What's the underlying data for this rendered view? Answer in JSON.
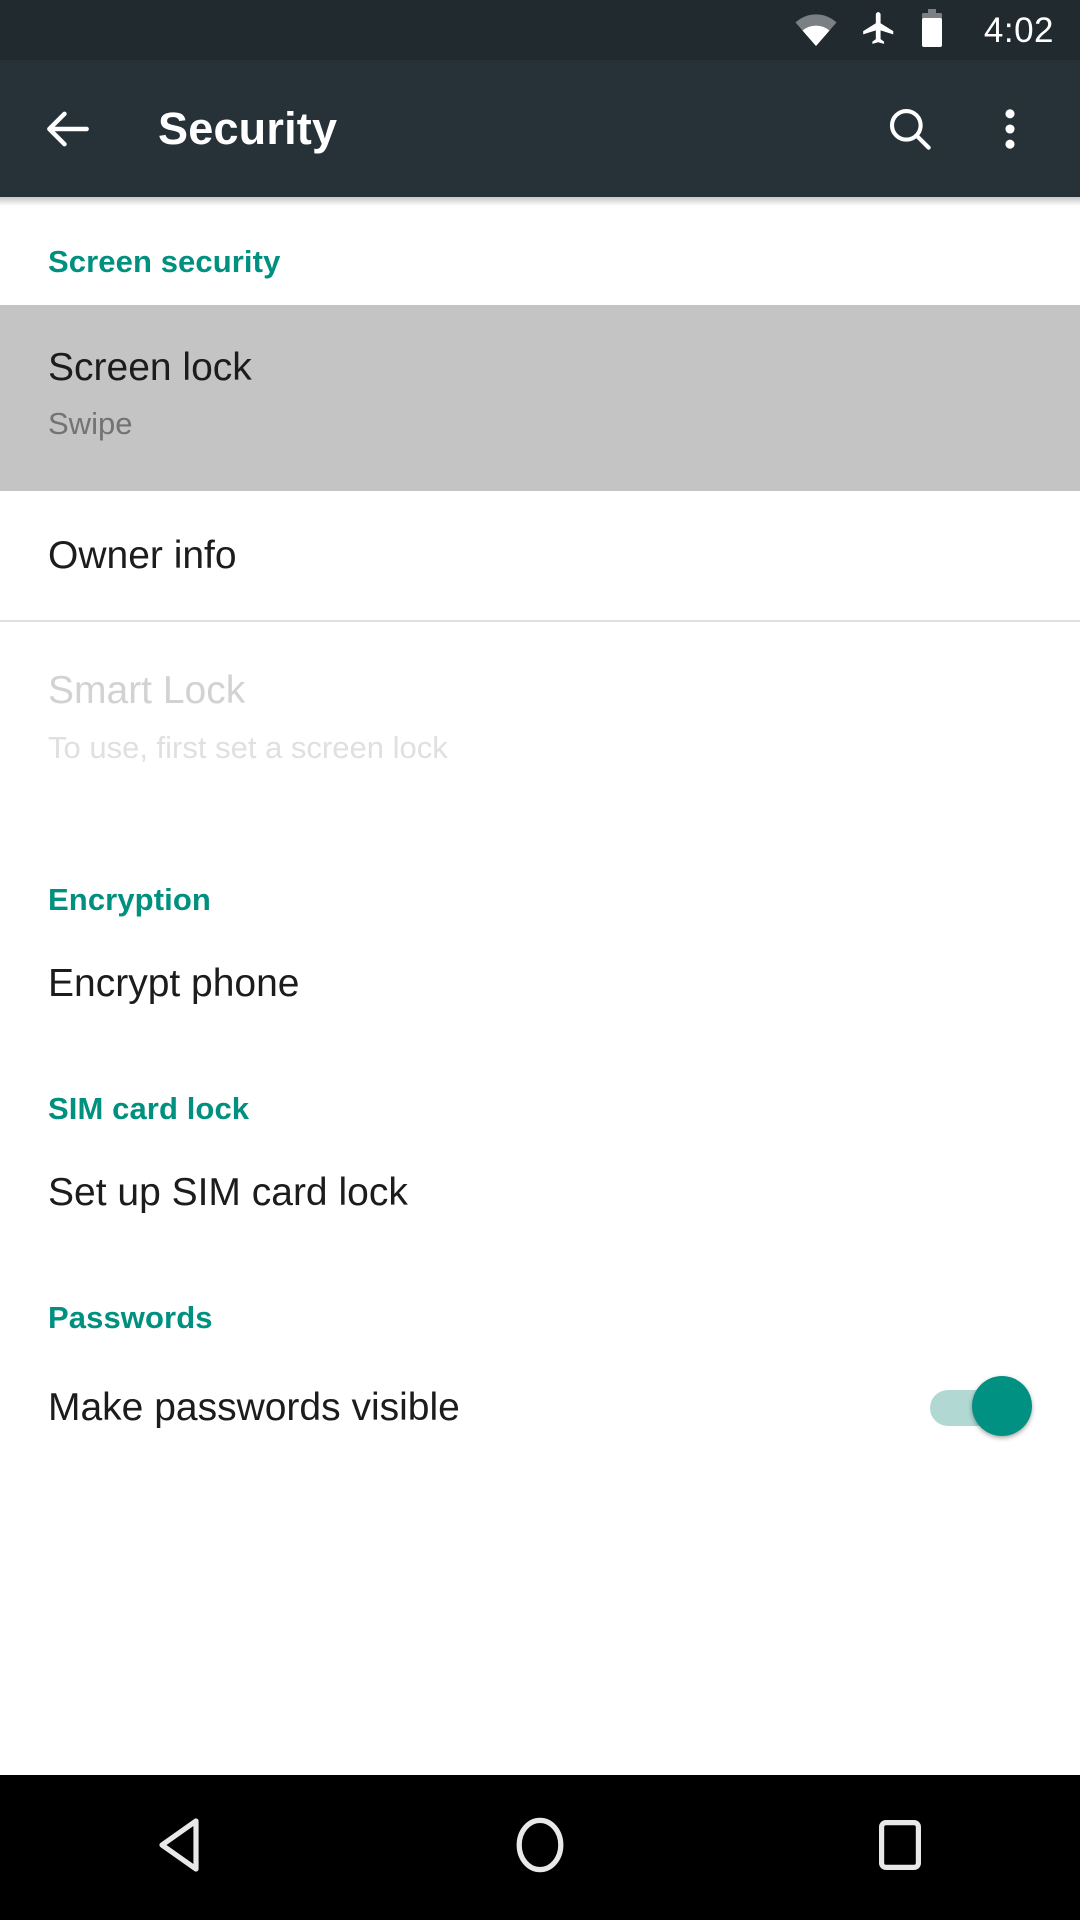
{
  "status_bar": {
    "icons": [
      "wifi-icon",
      "airplane-mode-icon",
      "battery-icon"
    ],
    "time": "4:02"
  },
  "app_bar": {
    "back_label": "back-arrow-icon",
    "title": "Security",
    "search_label": "search-icon",
    "overflow_label": "more-options-icon"
  },
  "colors": {
    "accent": "#00907f",
    "toggle_on": "#009183",
    "toggle_track": "#b2d8d4",
    "appbar": "#263238",
    "statusbar": "#212a2e",
    "highlight": "#c4c4c4",
    "navbar": "#000000"
  },
  "sections": [
    {
      "header": "Screen security",
      "items": [
        {
          "title": "Screen lock",
          "subtitle": "Swipe",
          "state": "highlighted"
        },
        {
          "title": "Owner info",
          "subtitle": "",
          "state": "normal"
        },
        {
          "title": "Smart Lock",
          "subtitle": "To use, first set a screen lock",
          "state": "disabled"
        }
      ]
    },
    {
      "header": "Encryption",
      "items": [
        {
          "title": "Encrypt phone",
          "subtitle": "",
          "state": "normal"
        }
      ]
    },
    {
      "header": "SIM card lock",
      "items": [
        {
          "title": "Set up SIM card lock",
          "subtitle": "",
          "state": "normal"
        }
      ]
    },
    {
      "header": "Passwords",
      "items": [
        {
          "title": "Make passwords visible",
          "subtitle": "",
          "state": "normal",
          "toggle": "on"
        }
      ]
    }
  ],
  "nav_bar": {
    "back": "back-triangle-icon",
    "home": "home-circle-icon",
    "recents": "recents-square-icon"
  }
}
